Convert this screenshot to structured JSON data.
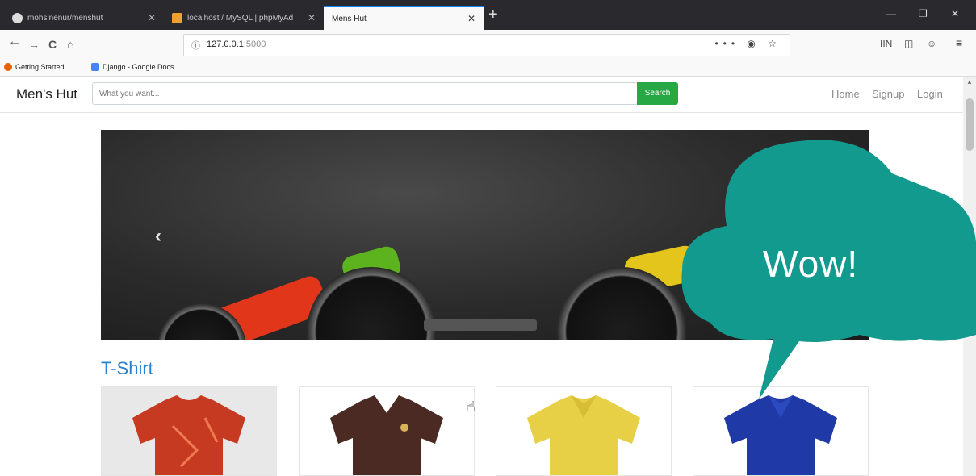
{
  "browser": {
    "tabs": [
      {
        "label": "mohsinenur/menshut",
        "icon": "github-icon"
      },
      {
        "label": "localhost / MySQL | phpMyAd",
        "icon": "phpmyadmin-icon"
      },
      {
        "label": "Mens Hut",
        "icon": "none"
      }
    ],
    "url": {
      "host": "127.0.0.1",
      "port": ":5000"
    },
    "bookmarks": [
      {
        "label": "Getting Started",
        "icon": "firefox-icon"
      },
      {
        "label": "Django - Google Docs",
        "icon": "docs-icon"
      }
    ],
    "controls": {
      "back": "←",
      "forward": "→",
      "reload": "C",
      "home": "⌂",
      "new_tab": "+",
      "more": "•••",
      "library": "IIN",
      "menu": "≡"
    }
  },
  "site": {
    "brand": "Men's Hut",
    "search": {
      "placeholder": "What you want...",
      "button": "Search"
    },
    "menu": [
      "Home",
      "Signup",
      "Login"
    ]
  },
  "carousel": {
    "prev": "‹"
  },
  "section": {
    "title": "T-Shirt"
  },
  "products": [
    {
      "color": "#c63a22",
      "name": "red-tshirt"
    },
    {
      "color": "#4a2a22",
      "name": "brown-tshirt"
    },
    {
      "color": "#e7d046",
      "name": "yellow-polo"
    },
    {
      "color": "#1f3aa6",
      "name": "blue-polo"
    }
  ],
  "overlay": {
    "text": "Wow!",
    "color": "#139a8f"
  },
  "colors": {
    "accent": "#2a7fce",
    "search_button": "#28a745",
    "tab_active_border": "#0a84ff"
  }
}
